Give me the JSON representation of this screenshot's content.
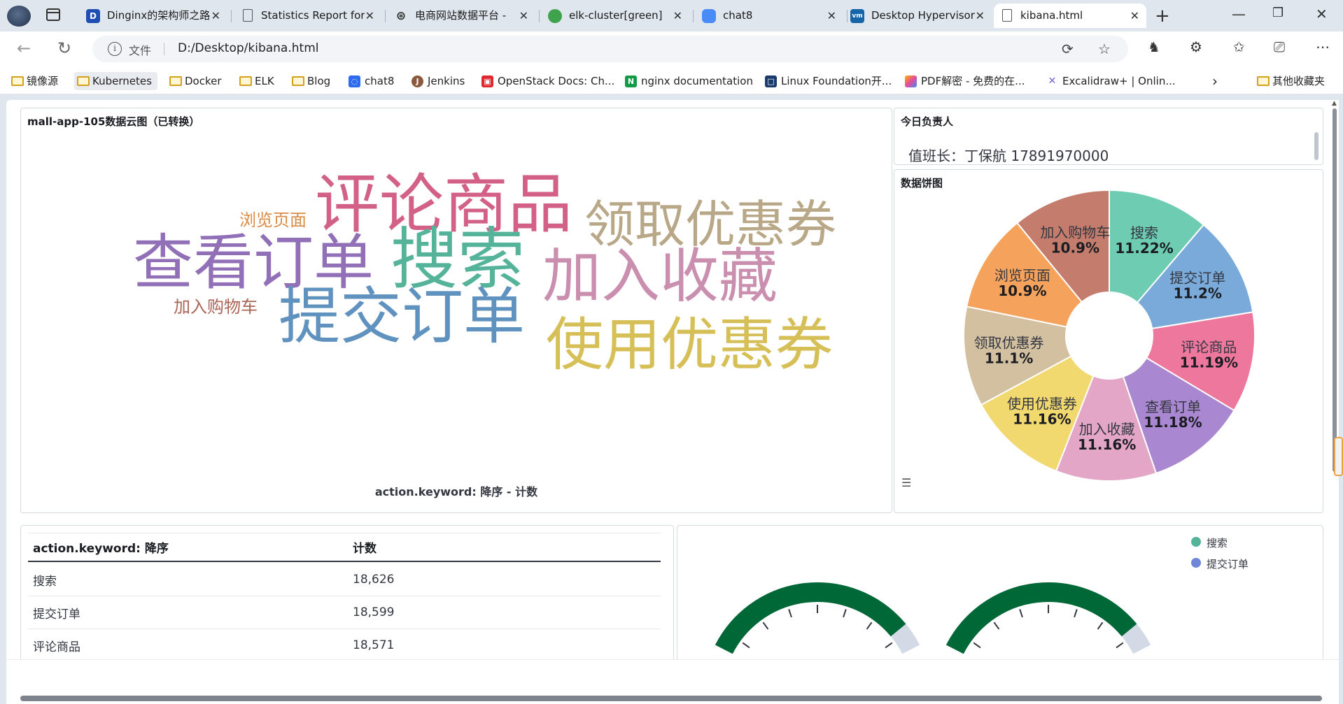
{
  "browser": {
    "tabs": [
      {
        "title": "Dinginx的架构师之路",
        "favicon_text": "D",
        "favicon_color": "#1e4fb5"
      },
      {
        "title": "Statistics Report for",
        "favicon_text": "▯",
        "favicon_color": "#ffffff"
      },
      {
        "title": "电商网站数据平台 -",
        "favicon_text": "◎",
        "favicon_color": "#ffffff"
      },
      {
        "title": "elk-cluster[green]",
        "favicon_text": "◉",
        "favicon_color": "#3fa34d"
      },
      {
        "title": "chat8",
        "favicon_text": "◌",
        "favicon_color": "#4a8cf7"
      },
      {
        "title": "Desktop Hypervisor",
        "favicon_text": "vm",
        "favicon_color": "#1565a8"
      },
      {
        "title": "kibana.html",
        "favicon_text": "▯",
        "favicon_color": "#ffffff"
      }
    ],
    "url_scheme": "文件",
    "url": "D:/Desktop/kibana.html",
    "bookmarks": [
      {
        "label": "镜像源",
        "type": "folder"
      },
      {
        "label": "Kubernetes",
        "type": "folder"
      },
      {
        "label": "Docker",
        "type": "folder"
      },
      {
        "label": "ELK",
        "type": "folder"
      },
      {
        "label": "Blog",
        "type": "folder"
      },
      {
        "label": "chat8",
        "type": "site",
        "color": "#2d6cf0",
        "glyph": "◌"
      },
      {
        "label": "Jenkins",
        "type": "site",
        "color": "#8b5a3c",
        "glyph": "J"
      },
      {
        "label": "OpenStack Docs: Ch...",
        "type": "site",
        "color": "#e0282e",
        "glyph": "▣"
      },
      {
        "label": "nginx documentation",
        "type": "site",
        "color": "#129a46",
        "glyph": "N"
      },
      {
        "label": "Linux Foundation开...",
        "type": "site",
        "color": "#1b3a6d",
        "glyph": "□"
      },
      {
        "label": "PDF解密 - 免费的在...",
        "type": "site",
        "color": "#e84b9b",
        "glyph": "▦"
      },
      {
        "label": "Excalidraw+ | Onlin...",
        "type": "site",
        "color": "#6965db",
        "glyph": "✕"
      }
    ],
    "other_bookmarks": "其他收藏夹"
  },
  "wordcloud_panel": {
    "title": "mall-app-105数据云图（已转换）",
    "footer": "action.keyword: 降序 - 计数",
    "words": [
      {
        "text": "评论商品",
        "color": "#d36086"
      },
      {
        "text": "浏览页面",
        "color": "#da8b45"
      },
      {
        "text": "领取优惠券",
        "color": "#b9a888"
      },
      {
        "text": "查看订单",
        "color": "#9170b8"
      },
      {
        "text": "搜索",
        "color": "#54b399"
      },
      {
        "text": "加入收藏",
        "color": "#ca8eae"
      },
      {
        "text": "加入购物车",
        "color": "#aa6556"
      },
      {
        "text": "提交订单",
        "color": "#6092c0"
      },
      {
        "text": "使用优惠券",
        "color": "#d6bf57"
      }
    ]
  },
  "duty_panel": {
    "title": "今日负责人",
    "text": "值班长：丁保航 17891970000"
  },
  "pie_panel": {
    "title": "数据饼图"
  },
  "chart_data": {
    "type": "pie",
    "donut": true,
    "categories": [
      "搜索",
      "提交订单",
      "评论商品",
      "查看订单",
      "加入收藏",
      "使用优惠券",
      "领取优惠券",
      "浏览页面",
      "加入购物车"
    ],
    "values": [
      11.22,
      11.2,
      11.19,
      11.18,
      11.16,
      11.16,
      11.1,
      10.9,
      10.9
    ],
    "labels": [
      "11.22%",
      "11.2%",
      "11.19%",
      "11.18%",
      "11.16%",
      "11.16%",
      "11.1%",
      "10.9%",
      "10.9%"
    ],
    "colors": [
      "#6dccb1",
      "#79aad9",
      "#ee789d",
      "#a987d1",
      "#e4a6c7",
      "#f1d86f",
      "#d2c0a0",
      "#f5a35c",
      "#c47c6c"
    ]
  },
  "table_panel": {
    "columns": [
      "action.keyword: 降序",
      "计数"
    ],
    "rows": [
      [
        "搜索",
        "18,626"
      ],
      [
        "提交订单",
        "18,599"
      ],
      [
        "评论商品",
        "18,571"
      ]
    ]
  },
  "gauge_panel": {
    "legend": [
      {
        "label": "搜索",
        "color": "#54b399"
      },
      {
        "label": "提交订单",
        "color": "#6f87d8"
      }
    ],
    "arc_color": "#006837",
    "track_color": "#d3dae6"
  }
}
